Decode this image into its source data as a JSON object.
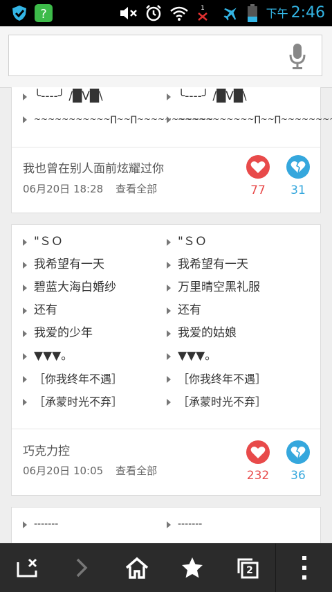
{
  "status_bar": {
    "ampm": "下午",
    "time": "2:46",
    "signal_badge": "1",
    "accent_color": "#33b5e5"
  },
  "search": {
    "placeholder": "",
    "value": ""
  },
  "card_top": {
    "left_lines": [
      "╰----╯ /█V█\\",
      "~~~~~~~~~~~∏~~∏~~~~~~~~~~~"
    ],
    "right_lines": [
      "╰----╯ /█V█\\",
      "~~~~~~~~~~~∏~~∏~~~~~~~~~~~"
    ],
    "title": "我也曾在别人面前炫耀过你",
    "date": "06月20日 18:28",
    "view_all": "查看全部",
    "likes": "77",
    "unlikes": "31"
  },
  "card_middle": {
    "left_lines": [
      "\"ＳＯ",
      "我希望有一天",
      "碧蓝大海白婚纱",
      "还有",
      "我爱的少年",
      "▼▼▼。",
      "［你我终年不遇］",
      "［承蒙时光不弃］"
    ],
    "right_lines": [
      "\"ＳＯ",
      "我希望有一天",
      "万里晴空黑礼服",
      "还有",
      "我爱的姑娘",
      "▼▼▼。",
      "［你我终年不遇］",
      "［承蒙时光不弃］"
    ],
    "title": "巧克力控",
    "date": "06月20日 10:05",
    "view_all": "查看全部",
    "likes": "232",
    "unlikes": "36"
  },
  "card_bottom": {
    "left_lines": [
      "-------"
    ],
    "right_lines": [
      "-------"
    ]
  },
  "toolbar": {
    "tab_count": "2",
    "icons": [
      "close-tab-icon",
      "forward-icon",
      "home-icon",
      "star-icon",
      "tabs-icon",
      "more-icon"
    ]
  },
  "colors": {
    "like": "#e84a4a",
    "unlike": "#35a7dd"
  }
}
